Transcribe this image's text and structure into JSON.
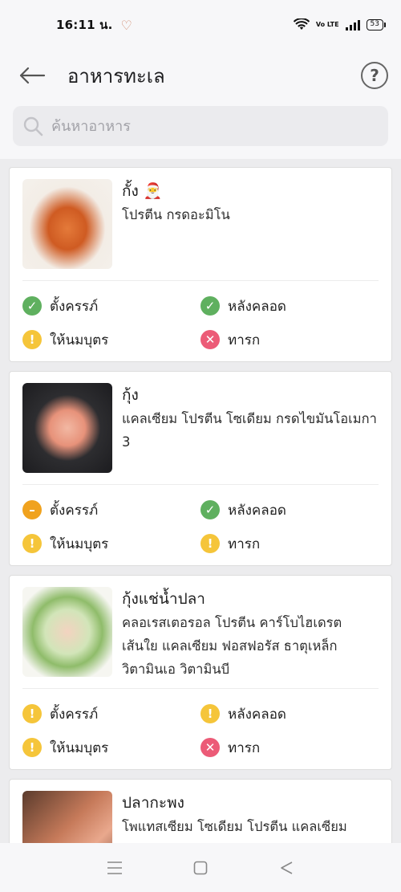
{
  "status_bar": {
    "time": "16:11 น.",
    "volte": "Vo LTE",
    "battery": "53"
  },
  "header": {
    "title": "อาหารทะเล",
    "help_label": "?"
  },
  "search": {
    "placeholder": "ค้นหาอาหาร"
  },
  "status_labels": {
    "pregnant": "ตั้งครรภ์",
    "postpartum": "หลังคลอด",
    "breastfeeding": "ให้นมบุตร",
    "infant": "ทารก"
  },
  "foods": [
    {
      "name": "กั้ง 🎅",
      "nutrients": "โปรตีน กรดอะมิโน",
      "pregnant": "ok",
      "postpartum": "ok",
      "breastfeeding": "warn",
      "infant": "no"
    },
    {
      "name": "กุ้ง",
      "nutrients": "แคลเซียม โปรตีน โซเดียม กรดไขมันโอเมกา 3",
      "pregnant": "avoid",
      "postpartum": "ok",
      "breastfeeding": "warn",
      "infant": "warn"
    },
    {
      "name": "กุ้งแช่น้ำปลา",
      "nutrients": "คลอเรสเตอรอล โปรตีน คาร์โบไฮเดรต เส้นใย แคลเซียม ฟอสฟอรัส ธาตุเหล็ก วิตามินเอ วิตามินบี",
      "pregnant": "warn",
      "postpartum": "warn",
      "breastfeeding": "warn",
      "infant": "no"
    },
    {
      "name": "ปลากะพง",
      "nutrients": "โพแทสเซียม โซเดียม โปรตีน แคลเซียม",
      "pregnant": "",
      "postpartum": "",
      "breastfeeding": "",
      "infant": ""
    }
  ],
  "icons": {
    "ok": "check-circle-icon",
    "warn": "exclamation-circle-icon",
    "avoid": "minus-circle-icon",
    "no": "cross-circle-icon"
  },
  "colors": {
    "ok": "#5fb05f",
    "warn": "#f5c53a",
    "avoid": "#f0a21e",
    "no": "#ec5b77"
  }
}
